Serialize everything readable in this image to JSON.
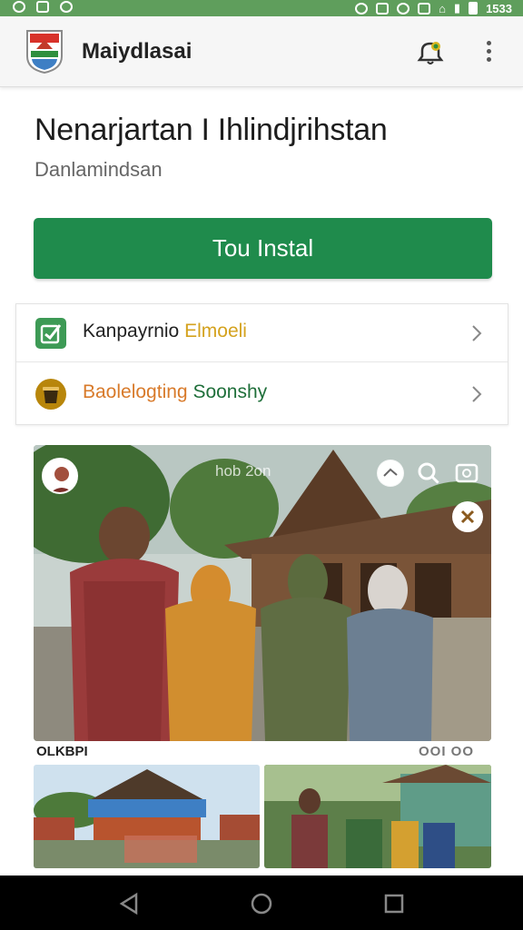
{
  "status_bar": {
    "time": "1533"
  },
  "app_bar": {
    "title": "Maiydlasai"
  },
  "main": {
    "title": "Nenarjartan I Ihlindjrihstan",
    "subtitle": "Danlamindsan",
    "primary_button": "Tou Instal"
  },
  "list": [
    {
      "part_a": "Kanpayrnio",
      "part_b": "Elmoeli",
      "icon": "check-badge-icon"
    },
    {
      "part_a": "Baolelogting",
      "part_b": "Soonshy",
      "icon": "bucket-icon"
    }
  ],
  "photo": {
    "watermark": "hob 2on",
    "caption_left": "OLKBPI",
    "caption_right": "OOI OO"
  },
  "colors": {
    "status_bar": "#5f9e5c",
    "primary": "#1f8b4c",
    "nav_bar": "#000000"
  }
}
